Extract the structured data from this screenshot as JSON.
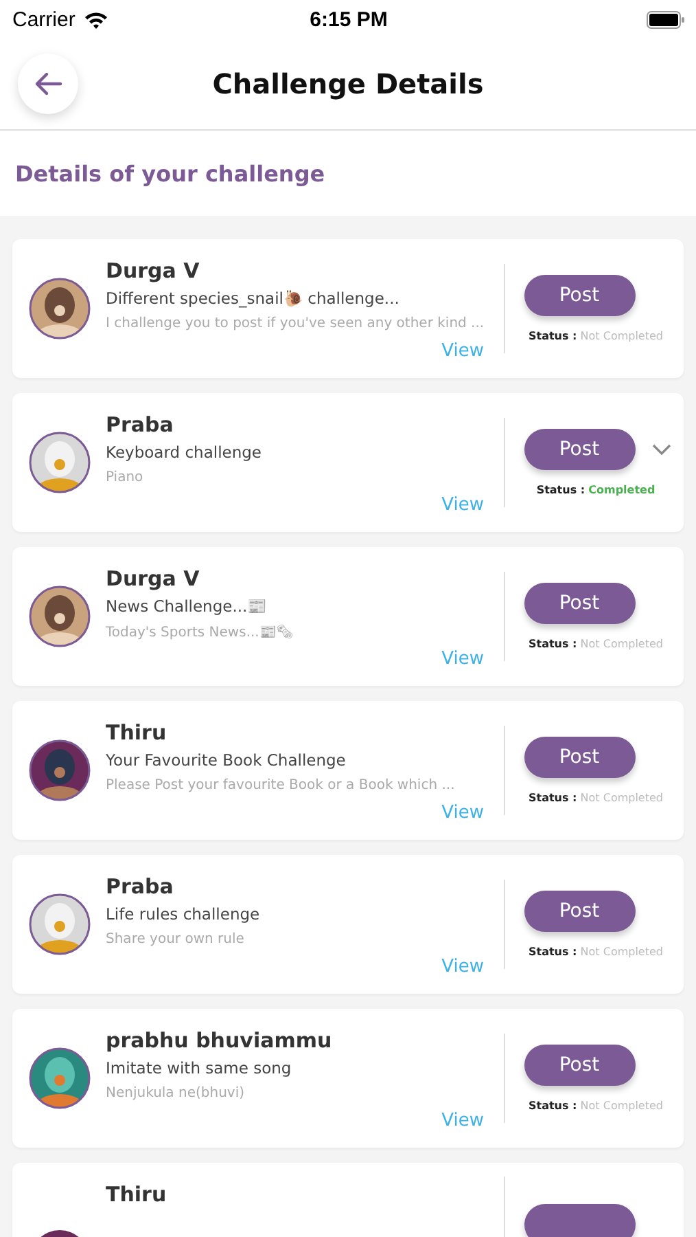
{
  "status_bar": {
    "carrier": "Carrier",
    "time": "6:15 PM"
  },
  "header": {
    "title": "Challenge Details"
  },
  "section_title": "Details of your challenge",
  "challenges": [
    {
      "name": "Durga V",
      "title": "Different species_snail🐌 challenge...",
      "description": "I challenge you to post if you've seen any other kind ...",
      "view": "View",
      "post": "Post",
      "status_label": "Status :",
      "status": "Not Completed",
      "completed": false,
      "show_toggle": false
    },
    {
      "name": "Praba",
      "title": "Keyboard challenge",
      "description": "Piano",
      "view": "View",
      "post": "Post",
      "status_label": "Status :",
      "status": "Completed",
      "completed": true,
      "show_toggle": true
    },
    {
      "name": "Durga V",
      "title": "News Challenge...📰",
      "description": "Today's Sports News...📰🗞",
      "view": "View",
      "post": "Post",
      "status_label": "Status :",
      "status": "Not Completed",
      "completed": false,
      "show_toggle": false
    },
    {
      "name": "Thiru",
      "title": "Your Favourite Book Challenge",
      "description": "Please Post your favourite Book or a Book which ...",
      "view": "View",
      "post": "Post",
      "status_label": "Status :",
      "status": "Not Completed",
      "completed": false,
      "show_toggle": false
    },
    {
      "name": "Praba",
      "title": "Life rules challenge",
      "description": "Share your own rule",
      "view": "View",
      "post": "Post",
      "status_label": "Status :",
      "status": "Not Completed",
      "completed": false,
      "show_toggle": false
    },
    {
      "name": "prabhu bhuviammu",
      "title": "Imitate with same song",
      "description": "Nenjukula ne(bhuvi)",
      "view": "View",
      "post": "Post",
      "status_label": "Status :",
      "status": "Not Completed",
      "completed": false,
      "show_toggle": false
    }
  ],
  "partial_challenge": {
    "name": "Thiru"
  }
}
